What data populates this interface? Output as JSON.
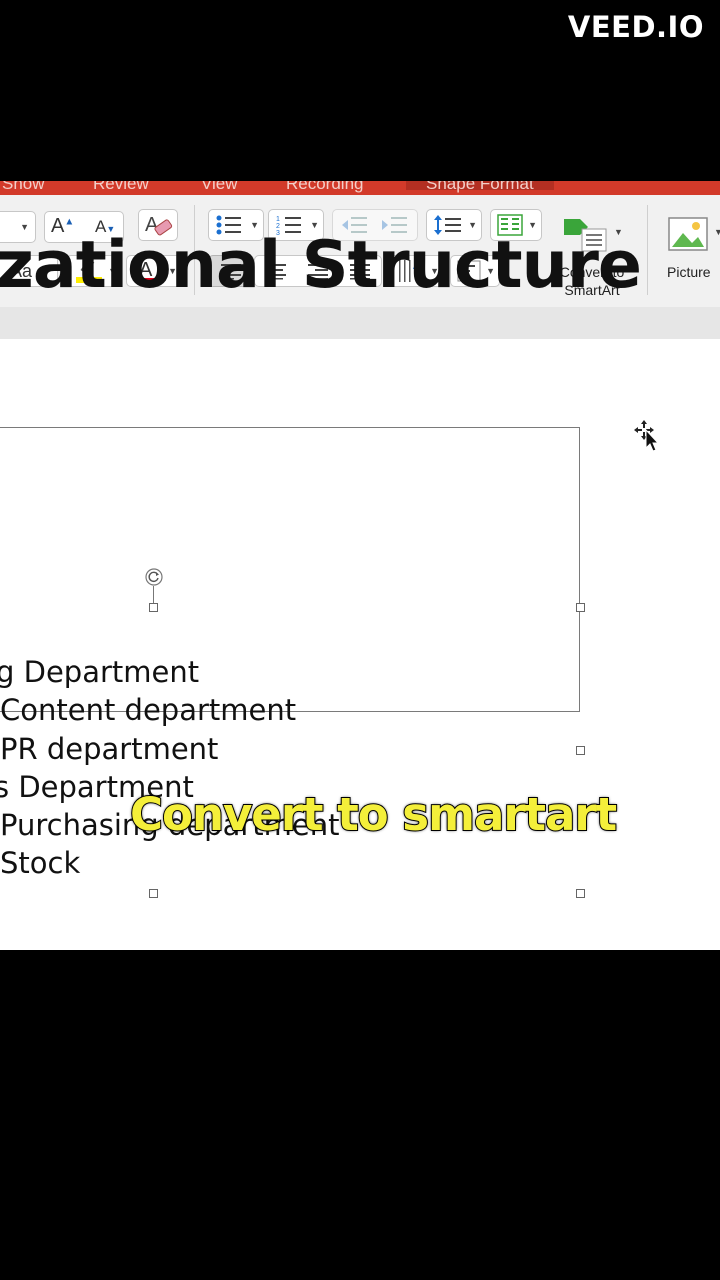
{
  "watermark": "VEED.IO",
  "ribbon_tabs": [
    "Show",
    "Review",
    "View",
    "Recording",
    "Shape Format"
  ],
  "ribbon": {
    "convert_label_line1": "Convert to",
    "convert_label_line2": "SmartArt",
    "picture_label": "Picture"
  },
  "slide": {
    "title": "zational Structure",
    "lines": [
      "g Department",
      "Content department",
      "PR department",
      "s Department",
      "Purchasing department",
      "Stock"
    ]
  },
  "caption": "Convert to smartart",
  "colors": {
    "ribbon_red": "#d23a2a",
    "caption_yellow": "#f4ef3a",
    "highlight_yellow": "#ffee00",
    "font_red": "#e0001a",
    "smartart_green": "#3aa53a"
  }
}
